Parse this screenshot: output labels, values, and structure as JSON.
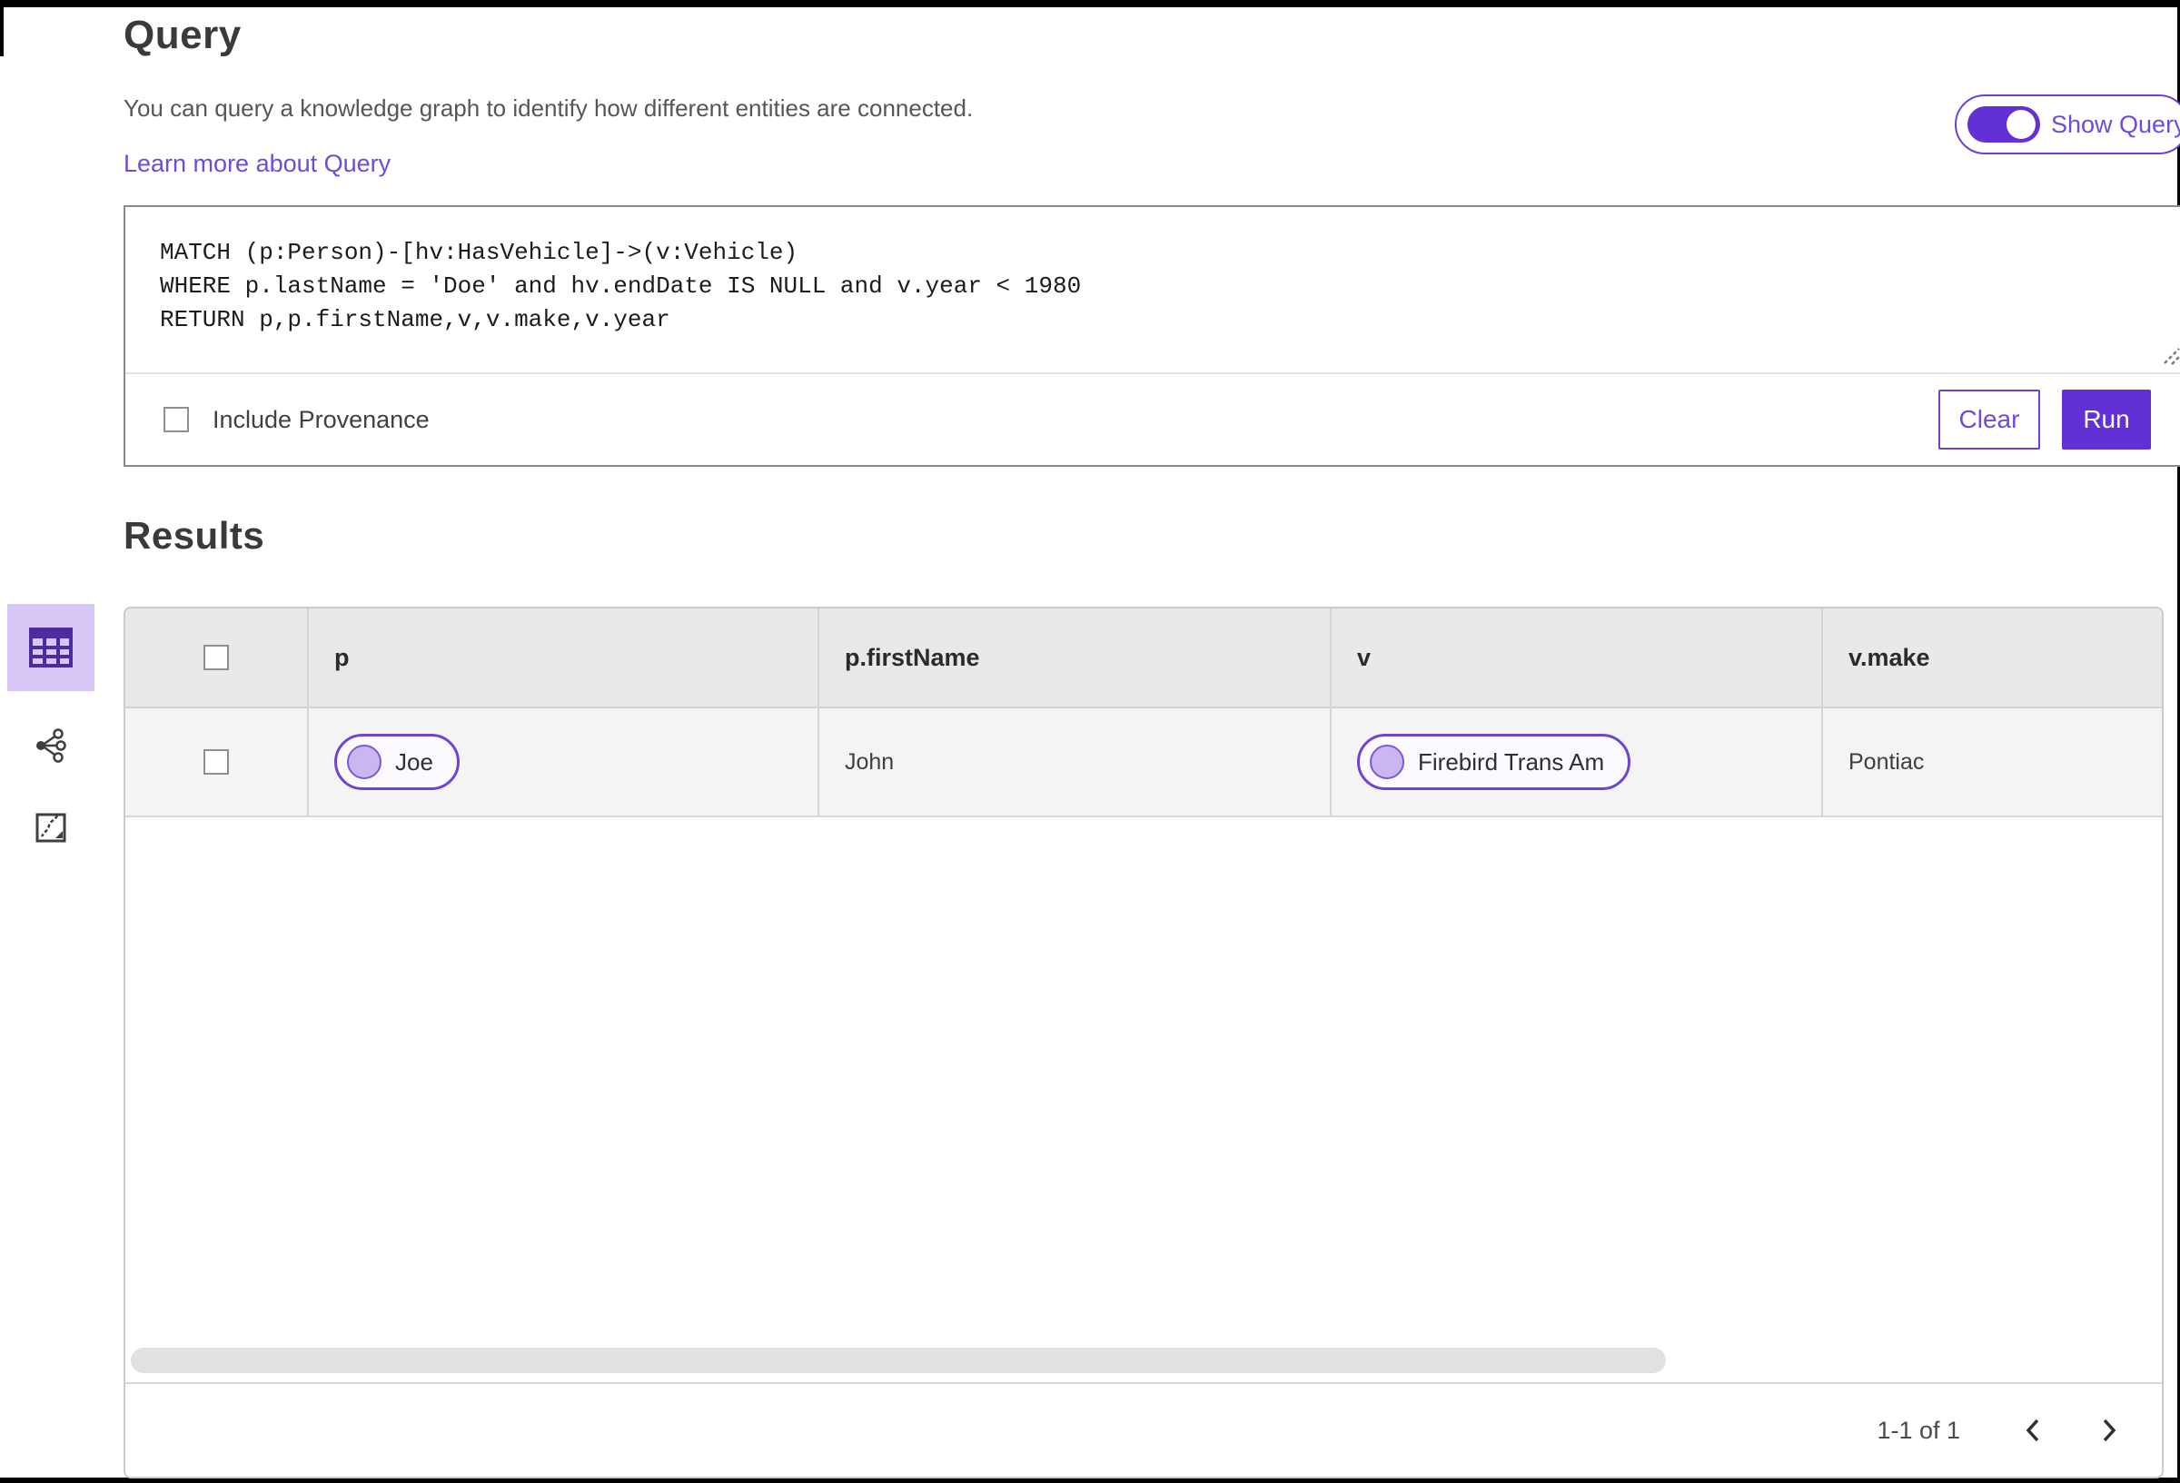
{
  "header": {
    "title": "Query",
    "description": "You can query a knowledge graph to identify how different entities are connected.",
    "learn_more_label": "Learn more about Query",
    "show_query_label": "Show Query",
    "show_query_state": "on"
  },
  "query_panel": {
    "code": "MATCH (p:Person)-[hv:HasVehicle]->(v:Vehicle)\nWHERE p.lastName = 'Doe' and hv.endDate IS NULL and v.year < 1980\nRETURN p,p.firstName,v,v.make,v.year",
    "include_provenance_label": "Include Provenance",
    "include_provenance_checked": false,
    "clear_label": "Clear",
    "run_label": "Run"
  },
  "results": {
    "title": "Results",
    "columns": [
      "p",
      "p.firstName",
      "v",
      "v.make"
    ],
    "rows": [
      {
        "p": "Joe",
        "p_firstName": "John",
        "v": "Firebird Trans Am",
        "v_make": "Pontiac",
        "selected": false
      }
    ],
    "pagination": {
      "range_label": "1-1 of 1"
    }
  },
  "sidebar": {
    "items": [
      {
        "icon": "table-view-icon",
        "selected": true
      },
      {
        "icon": "graph-view-icon",
        "selected": false
      },
      {
        "icon": "map-view-icon",
        "selected": false
      }
    ]
  },
  "colors": {
    "accent_purple": "#6330d6",
    "accent_purple_border": "#6e41d4",
    "link_purple": "#6f4bd8",
    "selected_icon_bg": "#d8c6f6",
    "pill_fill": "#fbfaff",
    "pill_dot": "#cbb7f0",
    "table_header_bg": "#e9e9e9",
    "table_row_bg": "#f4f4f4"
  }
}
